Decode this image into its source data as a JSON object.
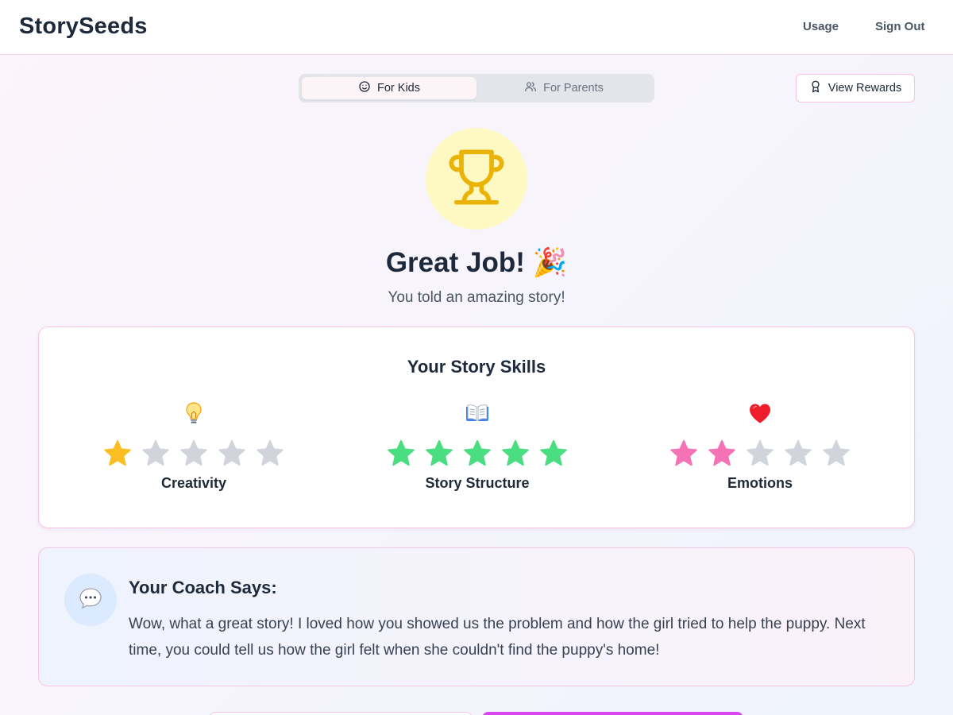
{
  "app": {
    "name": "StorySeeds"
  },
  "nav": {
    "usage": "Usage",
    "sign_out": "Sign Out"
  },
  "toggle": {
    "kids_label": "For Kids",
    "parents_label": "For Parents",
    "active": "kids"
  },
  "rewards": {
    "label": "View Rewards"
  },
  "hero": {
    "title": "Great Job! 🎉",
    "subtitle": "You told an amazing story!"
  },
  "skills": {
    "title": "Your Story Skills",
    "items": [
      {
        "label": "Creativity",
        "icon": "lightbulb-icon",
        "rating": 1,
        "max": 5,
        "color": "#fbbf24"
      },
      {
        "label": "Story Structure",
        "icon": "open-book-icon",
        "rating": 5,
        "max": 5,
        "color": "#4ade80"
      },
      {
        "label": "Emotions",
        "icon": "heart-icon",
        "rating": 2,
        "max": 5,
        "color": "#f472b6"
      }
    ],
    "empty_star_color": "#d1d5db"
  },
  "coach": {
    "title": "Your Coach Says:",
    "message": "Wow, what a great story! I loved how you showed us the problem and how the girl tried to help the puppy. Next time, you could tell us how the girl felt when she couldn't find the puppy's home!"
  },
  "colors": {
    "accent": "#d946ef",
    "border_pink": "#f4c6e3",
    "trophy": "#eab308",
    "trophy_bg": "#fef9c3"
  }
}
